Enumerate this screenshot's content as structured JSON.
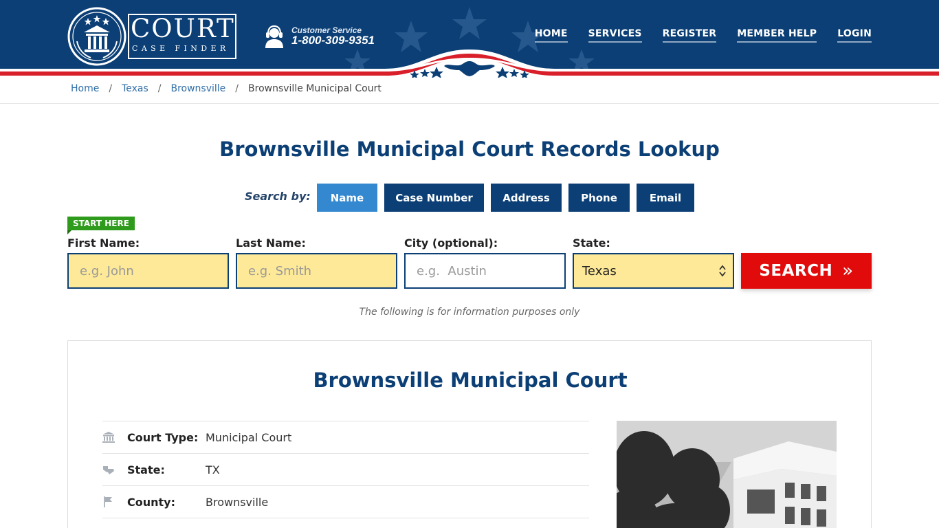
{
  "logo": {
    "main": "COURT",
    "sub": "CASE FINDER"
  },
  "customer_service": {
    "label": "Customer Service",
    "phone": "1-800-309-9351"
  },
  "nav": [
    "HOME",
    "SERVICES",
    "REGISTER",
    "MEMBER HELP",
    "LOGIN"
  ],
  "breadcrumb": {
    "home": "Home",
    "state": "Texas",
    "city": "Brownsville",
    "current": "Brownsville Municipal Court",
    "separator": "/"
  },
  "search": {
    "title": "Brownsville Municipal Court Records Lookup",
    "search_by_label": "Search by:",
    "tabs": [
      "Name",
      "Case Number",
      "Address",
      "Phone",
      "Email"
    ],
    "active_tab": "Name",
    "start_here": "START HERE",
    "first_name": {
      "label": "First Name:",
      "placeholder": "e.g. John"
    },
    "last_name": {
      "label": "Last Name:",
      "placeholder": "e.g. Smith"
    },
    "city": {
      "label": "City (optional):",
      "placeholder": "e.g.  Austin"
    },
    "state": {
      "label": "State:",
      "value": "Texas"
    },
    "button": "SEARCH",
    "note": "The following is for information purposes only"
  },
  "court": {
    "title": "Brownsville Municipal Court",
    "rows": [
      {
        "icon": "courthouse-icon",
        "label": "Court Type:",
        "value": "Municipal Court"
      },
      {
        "icon": "state-map-icon",
        "label": "State:",
        "value": "TX"
      },
      {
        "icon": "flag-icon",
        "label": "County:",
        "value": "Brownsville"
      }
    ]
  },
  "colors": {
    "navy": "#0b3f75",
    "accent_blue": "#3388cf",
    "search_red": "#e10b0b",
    "field_yellow": "#fde998",
    "start_green": "#2e9b1c"
  }
}
